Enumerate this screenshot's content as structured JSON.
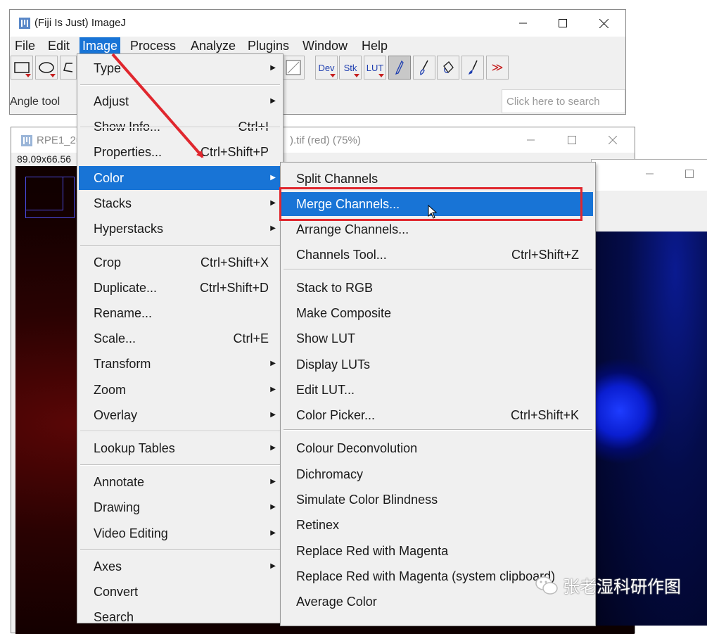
{
  "main_window": {
    "title": "(Fiji Is Just) ImageJ",
    "menus": [
      "File",
      "Edit",
      "Image",
      "Process",
      "Analyze",
      "Plugins",
      "Window",
      "Help"
    ],
    "active_menu": "Image",
    "status": "Angle tool",
    "search_placeholder": "Click here to search",
    "tool_labels": {
      "dev": "Dev",
      "stk": "Stk",
      "lut": "LUT",
      "more": "≫"
    }
  },
  "image_window": {
    "title_left": "RPE1_2u",
    "title_right": ").tif (red) (75%)",
    "info": "89.09x66.56"
  },
  "image_menu": {
    "items": [
      {
        "label": "Type",
        "shortcut": "",
        "submenu": true
      },
      {
        "label": "Adjust",
        "shortcut": "",
        "submenu": true
      },
      {
        "label": "Show Info...",
        "shortcut": "Ctrl+I",
        "submenu": false
      },
      {
        "label": "Properties...",
        "shortcut": "Ctrl+Shift+P",
        "submenu": false
      },
      {
        "label": "Color",
        "shortcut": "",
        "submenu": true,
        "highlighted": true
      },
      {
        "label": "Stacks",
        "shortcut": "",
        "submenu": true
      },
      {
        "label": "Hyperstacks",
        "shortcut": "",
        "submenu": true
      },
      {
        "label": "Crop",
        "shortcut": "Ctrl+Shift+X",
        "submenu": false
      },
      {
        "label": "Duplicate...",
        "shortcut": "Ctrl+Shift+D",
        "submenu": false
      },
      {
        "label": "Rename...",
        "shortcut": "",
        "submenu": false
      },
      {
        "label": "Scale...",
        "shortcut": "Ctrl+E",
        "submenu": false
      },
      {
        "label": "Transform",
        "shortcut": "",
        "submenu": true
      },
      {
        "label": "Zoom",
        "shortcut": "",
        "submenu": true
      },
      {
        "label": "Overlay",
        "shortcut": "",
        "submenu": true
      },
      {
        "label": "Lookup Tables",
        "shortcut": "",
        "submenu": true
      },
      {
        "label": "Annotate",
        "shortcut": "",
        "submenu": true
      },
      {
        "label": "Drawing",
        "shortcut": "",
        "submenu": true
      },
      {
        "label": "Video Editing",
        "shortcut": "",
        "submenu": true
      },
      {
        "label": "Axes",
        "shortcut": "",
        "submenu": true
      },
      {
        "label": "Convert",
        "shortcut": "",
        "submenu": false
      },
      {
        "label": "Search",
        "shortcut": "",
        "submenu": false
      }
    ]
  },
  "color_menu": {
    "items": [
      {
        "label": "Split Channels",
        "shortcut": ""
      },
      {
        "label": "Merge Channels...",
        "shortcut": "",
        "highlighted": true
      },
      {
        "label": "Arrange Channels...",
        "shortcut": ""
      },
      {
        "label": "Channels Tool...",
        "shortcut": "Ctrl+Shift+Z"
      },
      {
        "label": "Stack to RGB",
        "shortcut": ""
      },
      {
        "label": "Make Composite",
        "shortcut": ""
      },
      {
        "label": "Show LUT",
        "shortcut": ""
      },
      {
        "label": "Display LUTs",
        "shortcut": ""
      },
      {
        "label": "Edit LUT...",
        "shortcut": ""
      },
      {
        "label": "Color Picker...",
        "shortcut": "Ctrl+Shift+K"
      },
      {
        "label": "Colour Deconvolution",
        "shortcut": ""
      },
      {
        "label": "Dichromacy",
        "shortcut": ""
      },
      {
        "label": "Simulate Color Blindness",
        "shortcut": ""
      },
      {
        "label": "Retinex",
        "shortcut": ""
      },
      {
        "label": "Replace Red with Magenta",
        "shortcut": ""
      },
      {
        "label": "Replace Red with Magenta (system clipboard)",
        "shortcut": ""
      },
      {
        "label": "Average Color",
        "shortcut": ""
      }
    ]
  },
  "watermark": "张老湿科研作图",
  "colors": {
    "highlight": "#1874d6",
    "annotation": "#e0272e"
  }
}
